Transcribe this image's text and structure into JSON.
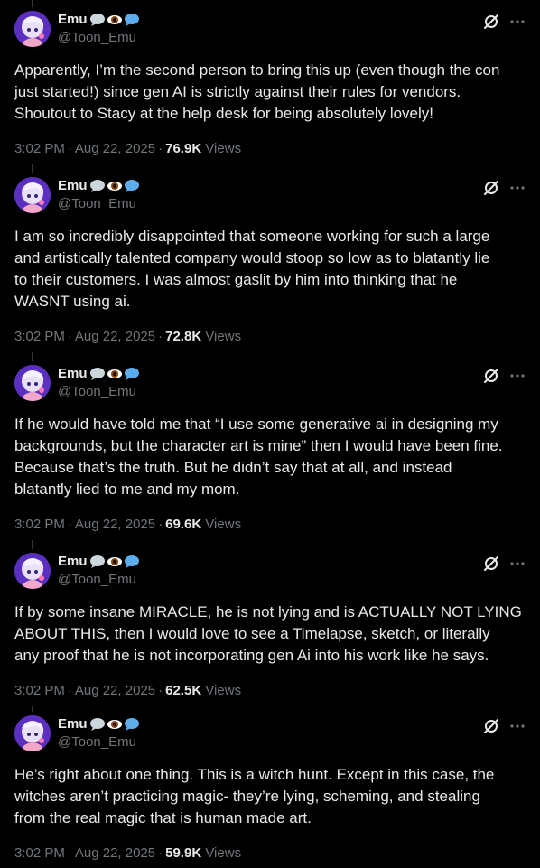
{
  "colors": {
    "background": "#000000",
    "text_primary": "#e7e9ea",
    "text_secondary": "#71767b",
    "thread_line": "#333639"
  },
  "posts": [
    {
      "display_name": "Emu",
      "name_emojis": [
        "speech-bubble-icon",
        "eye-icon",
        "speech-bubble-icon"
      ],
      "handle": "@Toon_Emu",
      "text": "Apparently, I’m the second person to bring this up (even though the con\njust started!) since gen AI is strictly against their rules for vendors.\nShoutout to Stacy at the help desk for being absolutely lovely!",
      "time": "3:02 PM",
      "date": "Aug 22, 2025",
      "views_count": "76.9K",
      "views_label": "Views"
    },
    {
      "display_name": "Emu",
      "name_emojis": [
        "speech-bubble-icon",
        "eye-icon",
        "speech-bubble-icon"
      ],
      "handle": "@Toon_Emu",
      "text": "I am so incredibly disappointed that someone working for such a large\nand artistically talented company would stoop so low as to blatantly lie\nto their customers. I was almost gaslit by him into thinking that he\nWASNT using ai.",
      "time": "3:02 PM",
      "date": "Aug 22, 2025",
      "views_count": "72.8K",
      "views_label": "Views"
    },
    {
      "display_name": "Emu",
      "name_emojis": [
        "speech-bubble-icon",
        "eye-icon",
        "speech-bubble-icon"
      ],
      "handle": "@Toon_Emu",
      "text": "If he would have told me that “I use some generative ai in designing my\nbackgrounds, but the character art is mine” then I would have been fine.\nBecause that’s the truth. But he didn’t  say that at all, and instead\nblatantly lied to me and my mom.",
      "time": "3:02 PM",
      "date": "Aug 22, 2025",
      "views_count": "69.6K",
      "views_label": "Views"
    },
    {
      "display_name": "Emu",
      "name_emojis": [
        "speech-bubble-icon",
        "eye-icon",
        "speech-bubble-icon"
      ],
      "handle": "@Toon_Emu",
      "text": "If by some insane MIRACLE, he is not lying and is ACTUALLY NOT LYING\nABOUT THIS, then I would love to see a Timelapse, sketch, or literally\nany proof that he is not incorporating gen Ai into his work like he says.",
      "time": "3:02 PM",
      "date": "Aug 22, 2025",
      "views_count": "62.5K",
      "views_label": "Views"
    },
    {
      "display_name": "Emu",
      "name_emojis": [
        "speech-bubble-icon",
        "eye-icon",
        "speech-bubble-icon"
      ],
      "handle": "@Toon_Emu",
      "text": "He’s right about one thing. This is a witch hunt. Except in this case, the\nwitches aren’t practicing magic- they’re lying, scheming, and stealing\nfrom the real magic that is human made art.",
      "time": "3:02 PM",
      "date": "Aug 22, 2025",
      "views_count": "59.9K",
      "views_label": "Views"
    }
  ]
}
